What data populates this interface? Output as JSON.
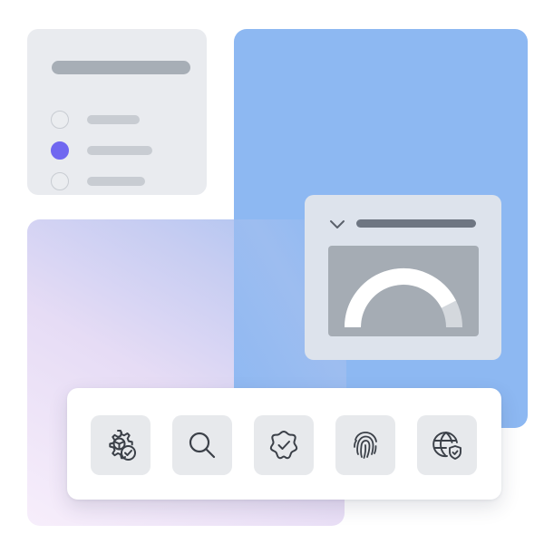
{
  "colors": {
    "accent": "#7067f0",
    "panel_blue": "#8db8f2",
    "card_gray": "#e9ebef",
    "icon_stroke": "#3b4048"
  },
  "radio_list": {
    "selected_index": 1,
    "options": [
      {
        "selected": false
      },
      {
        "selected": true
      },
      {
        "selected": false
      }
    ]
  },
  "gauge": {
    "collapsed_icon": "chevron-down-icon",
    "fill_fraction": 0.85
  },
  "toolbar": {
    "buttons": [
      {
        "icon": "gear-check-icon"
      },
      {
        "icon": "search-icon"
      },
      {
        "icon": "verified-badge-icon"
      },
      {
        "icon": "fingerprint-icon"
      },
      {
        "icon": "globe-shield-icon"
      }
    ]
  }
}
